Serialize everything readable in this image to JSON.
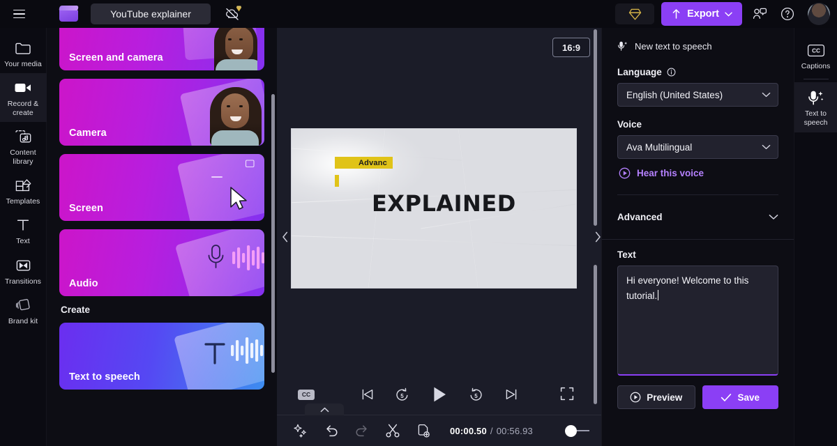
{
  "topbar": {
    "menu_icon": "hamburger-icon",
    "logo_icon": "clapperboard-logo",
    "project_title": "YouTube explainer",
    "cloud_status_icon": "cloud-offline-icon",
    "premium_icon": "diamond-icon",
    "export_label": "Export",
    "export_icon": "upload-icon",
    "export_chevron": "chevron-down-icon",
    "collaborate_icon": "collaborate-icon",
    "help_icon": "help-circle-icon",
    "avatar_name": "user-avatar"
  },
  "left_rail": {
    "items": [
      {
        "label": "Your media",
        "icon": "folder-icon",
        "active": false
      },
      {
        "label": "Record & create",
        "icon": "video-camera-icon",
        "active": true
      },
      {
        "label": "Content library",
        "icon": "content-library-icon",
        "active": false
      },
      {
        "label": "Templates",
        "icon": "templates-icon",
        "active": false
      },
      {
        "label": "Text",
        "icon": "text-icon",
        "active": false
      },
      {
        "label": "Transitions",
        "icon": "transitions-icon",
        "active": false
      },
      {
        "label": "Brand kit",
        "icon": "brand-kit-icon",
        "active": false
      }
    ]
  },
  "cards_panel": {
    "record_cards": [
      {
        "label": "Screen and camera",
        "art": "screen-and-camera-art",
        "theme": "purple"
      },
      {
        "label": "Camera",
        "art": "camera-art",
        "theme": "purple"
      },
      {
        "label": "Screen",
        "art": "screen-art",
        "theme": "purple"
      },
      {
        "label": "Audio",
        "art": "audio-art",
        "theme": "purple"
      }
    ],
    "create_heading": "Create",
    "create_cards": [
      {
        "label": "Text to speech",
        "art": "text-to-speech-art",
        "theme": "blue"
      }
    ]
  },
  "preview": {
    "aspect_ratio": "16:9",
    "collapse_left_icon": "chevron-left-icon",
    "stage": {
      "highlight_text": "Advanc",
      "title": "EXPLAINED"
    },
    "controls": {
      "captions_label": "CC",
      "skip_start_icon": "skip-to-start-icon",
      "back5_icon": "rewind-5-icon",
      "back5_label": "5",
      "play_icon": "play-icon",
      "forward5_icon": "forward-5-icon",
      "forward5_label": "5",
      "skip_end_icon": "skip-to-end-icon",
      "fullscreen_icon": "fullscreen-icon"
    },
    "timeline_tab_icon": "chevron-up-icon"
  },
  "bottombar": {
    "magic_icon": "magic-wand-icon",
    "undo_icon": "undo-icon",
    "redo_icon": "redo-icon",
    "split_icon": "scissors-icon",
    "duplicate_icon": "duplicate-icon",
    "current_time": "00:00.50",
    "time_separator": "/",
    "total_time": "00:56.93",
    "zoom_slider_name": "timeline-zoom-slider"
  },
  "properties": {
    "header_icon": "text-to-speech-icon",
    "header_label": "New text to speech",
    "collapse_right_icon": "chevron-right-icon",
    "language": {
      "label": "Language",
      "info_icon": "info-icon",
      "value": "English (United States)",
      "chevron": "chevron-down-icon"
    },
    "voice": {
      "label": "Voice",
      "value": "Ava Multilingual",
      "chevron": "chevron-down-icon"
    },
    "hear_voice": {
      "label": "Hear this voice",
      "icon": "play-circle-icon"
    },
    "advanced": {
      "label": "Advanced",
      "chevron": "chevron-down-icon"
    },
    "text": {
      "label": "Text",
      "value": "Hi everyone! Welcome to this tutorial."
    },
    "actions": {
      "preview_label": "Preview",
      "preview_icon": "play-circle-icon",
      "save_label": "Save",
      "save_icon": "check-icon"
    }
  },
  "right_rail": {
    "items": [
      {
        "label": "Captions",
        "icon": "closed-captions-icon",
        "active": false
      },
      {
        "label": "Text to speech",
        "icon": "text-to-speech-icon",
        "active": true
      }
    ]
  },
  "colors": {
    "accent": "#8b3ff5",
    "accent_text": "#b581ff",
    "card_magenta": "#cc15c9",
    "card_purple": "#8431f0",
    "card_blue": "#3d8df0",
    "highlight_yellow": "#e0c318",
    "premium_gold": "#d8b648",
    "panel_bg": "#0d0d14",
    "center_bg": "#1b1c28"
  }
}
